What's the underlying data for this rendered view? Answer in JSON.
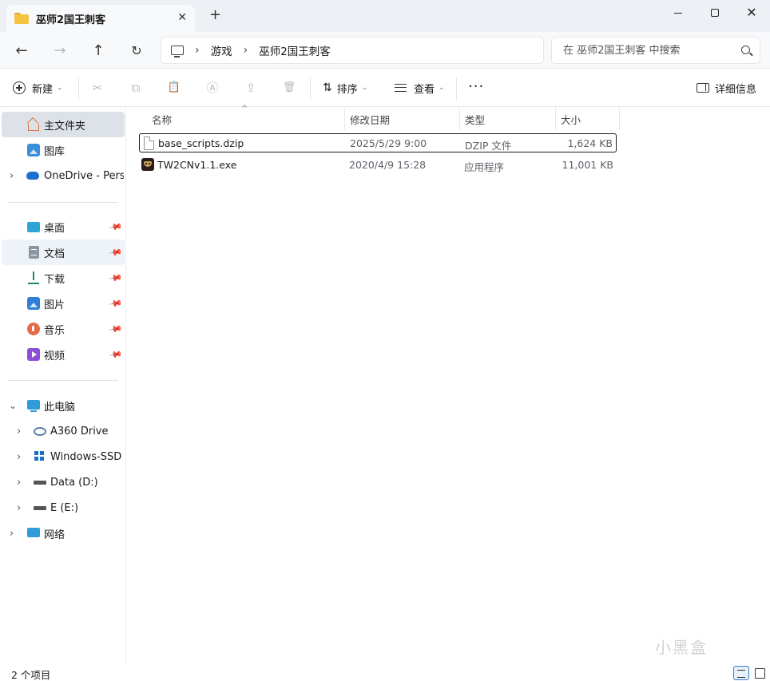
{
  "window": {
    "tab_title": "巫师2国王刺客",
    "new_tab_symbol": "+",
    "close_tab_symbol": "✕",
    "close_symbol": "✕"
  },
  "navigation": {
    "back": "←",
    "forward": "→",
    "up": "↑",
    "refresh": "↻",
    "breadcrumb": [
      "游戏",
      "巫师2国王刺客"
    ],
    "search_placeholder": "在 巫师2国王刺客 中搜索"
  },
  "toolbar": {
    "new_label": "新建",
    "sort_label": "排序",
    "view_label": "查看",
    "more_label": "···",
    "details_label": "详细信息",
    "cut_icon": "✂",
    "copy_icon": "⧉",
    "paste_icon": "📋",
    "rename_icon": "Ⓐ",
    "share_icon": "⇪",
    "delete_icon": "🗑",
    "caret": "⌄",
    "sort_icon": "⇅"
  },
  "sidebar": {
    "quick": [
      {
        "label": "主文件夹",
        "icon": "home-icon"
      },
      {
        "label": "图库",
        "icon": "gallery-icon"
      },
      {
        "label": "OneDrive - Perso",
        "icon": "onedrive-icon"
      }
    ],
    "pinned": [
      {
        "label": "桌面",
        "icon": "desktop-icon"
      },
      {
        "label": "文档",
        "icon": "documents-icon"
      },
      {
        "label": "下载",
        "icon": "download-icon"
      },
      {
        "label": "图片",
        "icon": "pictures-icon"
      },
      {
        "label": "音乐",
        "icon": "music-icon"
      },
      {
        "label": "视频",
        "icon": "video-icon"
      }
    ],
    "this_pc": {
      "label": "此电脑",
      "icon": "this-pc-icon"
    },
    "drives": [
      {
        "label": "A360 Drive",
        "icon": "a360-icon"
      },
      {
        "label": "Windows-SSD (C",
        "icon": "windows-drive-icon"
      },
      {
        "label": "Data (D:)",
        "icon": "drive-icon"
      },
      {
        "label": "E (E:)",
        "icon": "drive-icon"
      }
    ],
    "network": {
      "label": "网络",
      "icon": "network-icon"
    },
    "pin_symbol": "📌",
    "chev_right": "›",
    "chev_down": "⌄"
  },
  "file_list": {
    "columns": [
      "名称",
      "修改日期",
      "类型",
      "大小"
    ],
    "sort_caret": "^",
    "rows": [
      {
        "name": "base_scripts.dzip",
        "date": "2025/5/29 9:00",
        "type": "DZIP 文件",
        "size": "1,624 KB"
      },
      {
        "name": "TW2CNv1.1.exe",
        "date": "2020/4/9 15:28",
        "type": "应用程序",
        "size": "11,001 KB"
      }
    ]
  },
  "status": {
    "item_count": "2 个项目"
  },
  "watermark": "小黑盒"
}
